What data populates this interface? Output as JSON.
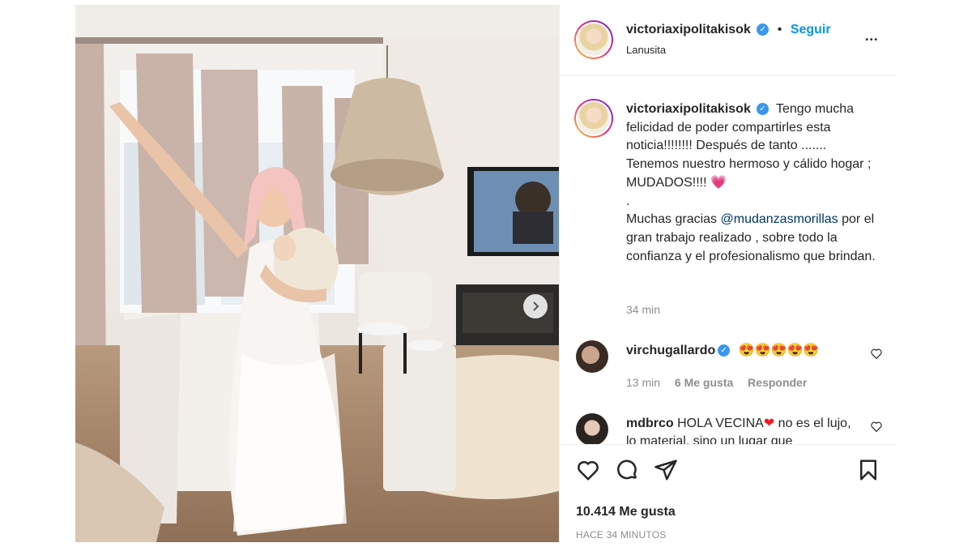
{
  "post": {
    "username": "victoriaxipolitakisok",
    "follow_label": "Seguir",
    "dot": "•",
    "location": "Lanusita",
    "more_label": "•••",
    "caption": {
      "line1": "Tengo mucha felicidad de poder compartirles esta noticia!!!!!!!! Después de tanto ....... Tenemos nuestro hermoso y cálido hogar ; MUDADOS!!!! ",
      "emoji": "💗",
      "period": ".",
      "thanks_before": "Muchas gracias ",
      "mention": "@mudanzasmorillas",
      "thanks_after": " por el gran trabajo realizado , sobre todo la confianza y el profesionalismo que brindan.",
      "time": "34 min"
    },
    "comments": [
      {
        "username": "virchugallardo",
        "text": "😍😍😍😍😍",
        "time": "13 min",
        "likes": "6 Me gusta",
        "reply": "Responder"
      },
      {
        "username": "mdbrco",
        "text_before": "HOLA VECINA",
        "heart": "❤",
        "text_after": "  no es el lujo, lo material, sino un lugar que"
      }
    ],
    "likes_label": "10.414 Me gusta",
    "posted_ago": "HACE 34 MINUTOS"
  },
  "colors": {
    "accent": "#0095f6",
    "verified": "#3897f0",
    "text": "#262626",
    "muted": "#8e8e8e"
  },
  "icons": [
    "verified-icon",
    "more-icon",
    "heart-icon",
    "comment-icon",
    "share-icon",
    "bookmark-icon",
    "chevron-right-icon",
    "comment-heart-icon"
  ]
}
